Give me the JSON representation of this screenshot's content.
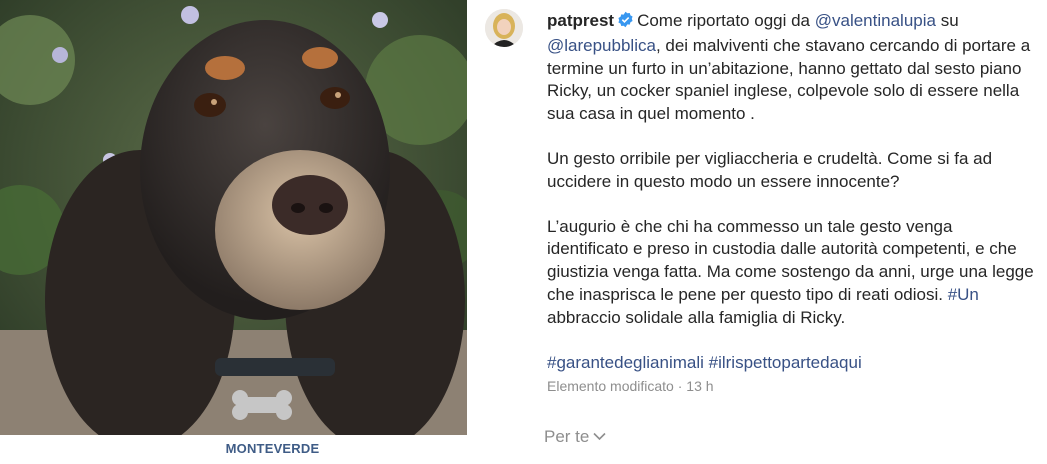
{
  "post": {
    "username": "patprest",
    "caption_parts": {
      "p1_a": "Come riportato oggi da ",
      "mention1": "@valentinalupia",
      "p1_b": " su ",
      "mention2": "@larepubblica",
      "p1_c": ", dei malviventi che stavano cercando di portare a termine un furto in un’abitazione, hanno gettato dal sesto piano Ricky, un cocker spaniel inglese, colpevole solo di essere nella sua casa in quel momento .",
      "p2": "Un gesto orribile per vigliaccheria e crudeltà. Come si fa ad uccidere in questo modo un essere innocente?",
      "p3": "L’augurio è che chi ha commesso un tale gesto venga identificato e preso in custodia dalle autorità competenti, e che giustizia venga fatta. Ma come sostengo da anni, urge una legge che inasprisca le pene per questo tipo di reati odiosi. ",
      "hashtag_inline": "#Un abbraccio solidale alla famiglia di Ricky.",
      "hashtag1": "#garantedeglianimali",
      "hashtag2": "#ilrispettopartedaqui"
    },
    "edited_label": "Elemento modificato · 13 h",
    "see_translation": "Per te",
    "location": "MONTEVERDE"
  },
  "icons": {
    "verified": "verified-badge-icon",
    "chevron": "chevron-down-icon"
  },
  "colors": {
    "link": "#385185",
    "text": "#262626",
    "muted": "#8e8e8e",
    "verified": "#3897f0",
    "location": "#3f5c86"
  }
}
